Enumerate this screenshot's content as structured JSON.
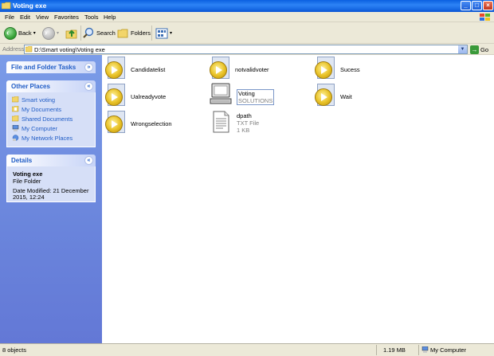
{
  "window": {
    "title": "Voting exe"
  },
  "menu": [
    "File",
    "Edit",
    "View",
    "Favorites",
    "Tools",
    "Help"
  ],
  "toolbar": {
    "back_label": "Back",
    "search_label": "Search",
    "folders_label": "Folders"
  },
  "address": {
    "label": "Address",
    "value": "D:\\Smart voting\\Voting exe",
    "go_label": "Go"
  },
  "sidebar": {
    "tasks_title": "File and Folder Tasks",
    "places_title": "Other Places",
    "places": [
      "Smart voting",
      "My Documents",
      "Shared Documents",
      "My Computer",
      "My Network Places"
    ],
    "details_title": "Details",
    "details": {
      "name": "Voting exe",
      "type": "File Folder",
      "modified_line1": "Date Modified: 21 December",
      "modified_line2": "2015, 12:24"
    }
  },
  "files": [
    {
      "name": "Candidatelist",
      "kind": "media"
    },
    {
      "name": "notvalidvoter",
      "kind": "media"
    },
    {
      "name": "Sucess",
      "kind": "media"
    },
    {
      "name": "Ualreadyvote",
      "kind": "media"
    },
    {
      "name": "Voting",
      "sub": "SOLUTIONS",
      "kind": "app"
    },
    {
      "name": "Wait",
      "kind": "media"
    },
    {
      "name": "Wrongselection",
      "kind": "media"
    },
    {
      "name": "dpath",
      "sub1": "TXT File",
      "sub2": "1 KB",
      "kind": "text"
    }
  ],
  "status": {
    "objects": "8 objects",
    "size": "1.19 MB",
    "location": "My Computer"
  }
}
